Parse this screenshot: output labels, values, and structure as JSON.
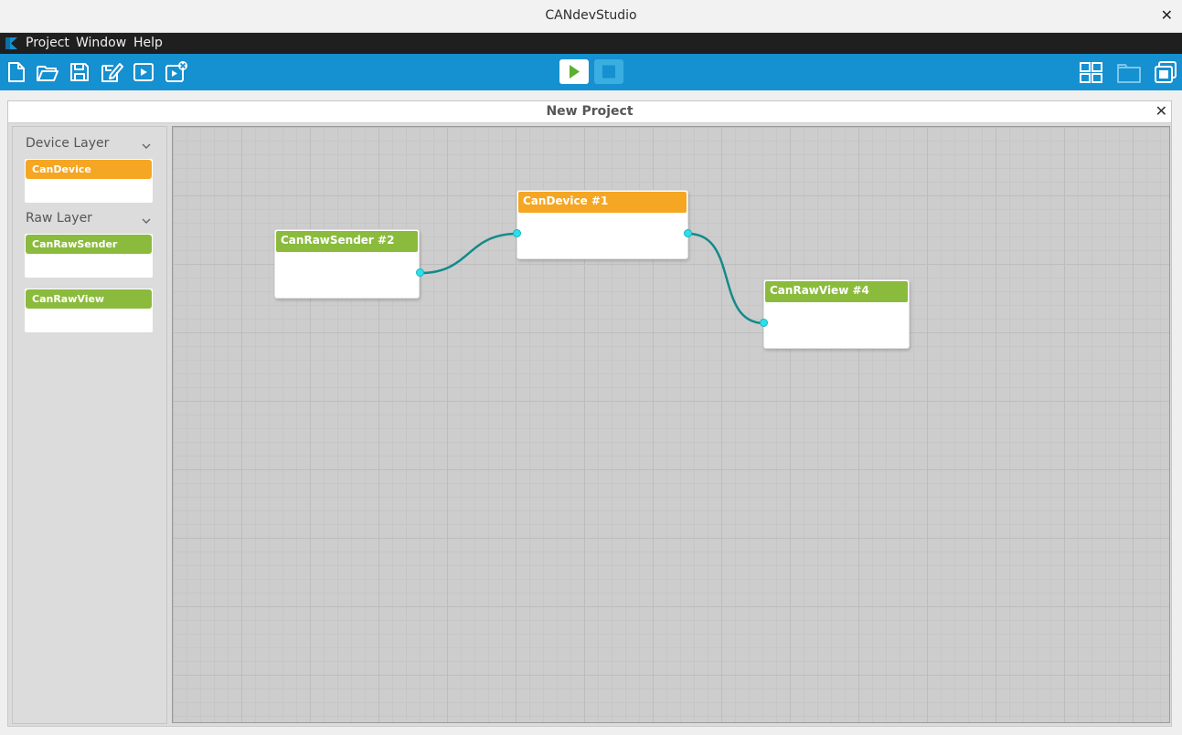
{
  "window": {
    "title": "CANdevStudio",
    "close_glyph": "✕"
  },
  "menu": {
    "items": [
      "Project",
      "Window",
      "Help"
    ]
  },
  "toolbar": {
    "left_icons": [
      "new-file-icon",
      "open-folder-icon",
      "save-icon",
      "save-as-icon",
      "start-simulation-icon",
      "close-project-icon"
    ],
    "right_icons": [
      "tile-windows-icon",
      "tabbed-view-icon",
      "cascade-windows-icon"
    ],
    "play_icon": "play-icon",
    "stop_icon": "stop-icon",
    "colors": {
      "bar": "#1590d0",
      "play": "#5cb030",
      "stop": "#1590d0"
    }
  },
  "project": {
    "title": "New Project",
    "close_glyph": "✕"
  },
  "sidebar": {
    "layers": [
      {
        "label": "Device Layer",
        "items": [
          {
            "label": "CanDevice",
            "color": "#f5a623"
          }
        ]
      },
      {
        "label": "Raw Layer",
        "items": [
          {
            "label": "CanRawSender",
            "color": "#8bbb3c"
          },
          {
            "label": "CanRawView",
            "color": "#8bbb3c"
          }
        ]
      }
    ]
  },
  "canvas": {
    "nodes": [
      {
        "id": "sender",
        "label": "CanRawSender #2",
        "color": "#8bbb3c"
      },
      {
        "id": "device",
        "label": "CanDevice #1",
        "color": "#f5a623"
      },
      {
        "id": "view",
        "label": "CanRawView #4",
        "color": "#8bbb3c"
      }
    ],
    "connection_color": "#138a8a"
  }
}
